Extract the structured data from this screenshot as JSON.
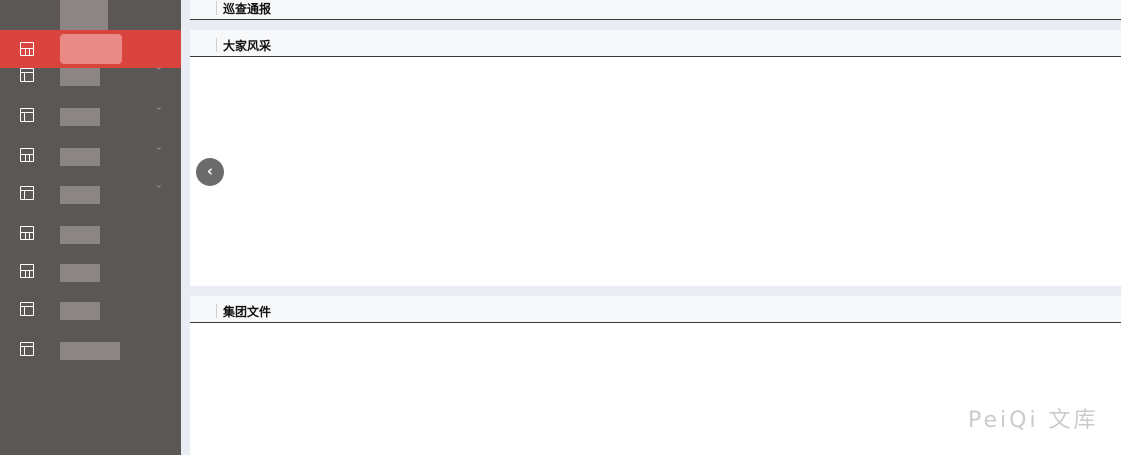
{
  "sidebar": {
    "items": [
      {
        "icon": "calculator-icon",
        "active": true
      },
      {
        "icon": "table-icon",
        "has_submenu": true
      },
      {
        "icon": "table-icon",
        "has_submenu": true
      },
      {
        "icon": "calculator-icon",
        "has_submenu": true
      },
      {
        "icon": "table-icon",
        "has_submenu": true
      },
      {
        "icon": "calculator-icon"
      },
      {
        "icon": "calculator-icon"
      },
      {
        "icon": "table-icon"
      },
      {
        "icon": "table-icon"
      }
    ],
    "active_color": "#d9443f",
    "background_color": "#5b5755"
  },
  "panels": {
    "inspection": {
      "title": "巡查通报"
    },
    "style": {
      "title": "大家风采"
    },
    "documents": {
      "title": "集团文件"
    }
  },
  "carousel": {
    "prev_icon": "chevron-left-icon",
    "prev_glyph": "‹"
  },
  "watermark": {
    "text": "PeiQi 文库"
  }
}
